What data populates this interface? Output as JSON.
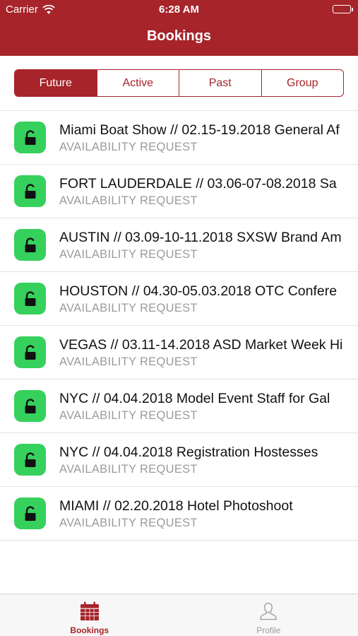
{
  "status_bar": {
    "carrier": "Carrier",
    "time": "6:28 AM"
  },
  "nav": {
    "title": "Bookings"
  },
  "segments": [
    {
      "label": "Future",
      "active": true
    },
    {
      "label": "Active",
      "active": false
    },
    {
      "label": "Past",
      "active": false
    },
    {
      "label": "Group",
      "active": false
    }
  ],
  "bookings": [
    {
      "title": "Miami Boat Show // 02.15-19.2018 General Af",
      "status": "AVAILABILITY REQUEST"
    },
    {
      "title": "FORT LAUDERDALE // 03.06-07-08.2018 Sa",
      "status": "AVAILABILITY REQUEST"
    },
    {
      "title": "AUSTIN // 03.09-10-11.2018 SXSW Brand Am",
      "status": "AVAILABILITY REQUEST"
    },
    {
      "title": "HOUSTON // 04.30-05.03.2018 OTC Confere",
      "status": "AVAILABILITY REQUEST"
    },
    {
      "title": "VEGAS // 03.11-14.2018 ASD Market Week Hi",
      "status": "AVAILABILITY REQUEST"
    },
    {
      "title": "NYC // 04.04.2018 Model Event Staff for Gal",
      "status": "AVAILABILITY REQUEST"
    },
    {
      "title": "NYC // 04.04.2018 Registration Hostesses",
      "status": "AVAILABILITY REQUEST"
    },
    {
      "title": "MIAMI // 02.20.2018 Hotel Photoshoot",
      "status": "AVAILABILITY REQUEST"
    }
  ],
  "tabbar": {
    "bookings_label": "Bookings",
    "profile_label": "Profile"
  },
  "colors": {
    "brand": "#a6242a",
    "lock_badge": "#35d15c",
    "subtitle": "#9b9b9b"
  },
  "icons": {
    "booking_row": "lock-icon",
    "tab_bookings": "calendar-icon",
    "tab_profile": "person-icon"
  }
}
